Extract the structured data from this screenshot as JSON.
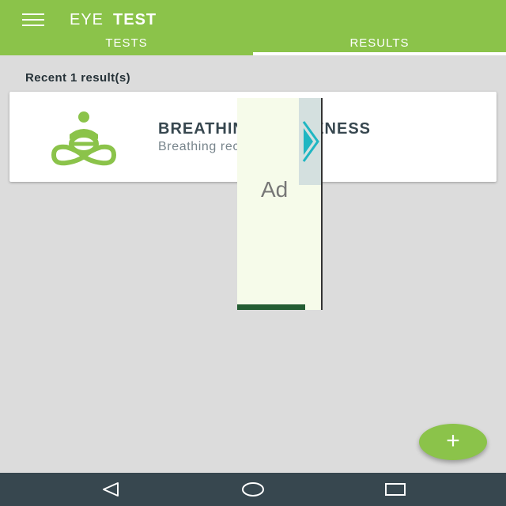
{
  "app": {
    "title_part1": "EYE",
    "title_part2": "TEST"
  },
  "tabs": [
    {
      "label": "TESTS",
      "selected": false
    },
    {
      "label": "RESULTS",
      "selected": true
    }
  ],
  "results": {
    "section_label": "Recent 1 result(s)",
    "items": [
      {
        "title": "BREATHING AWARENESS",
        "subtitle": "Breathing record / today",
        "icon": "meditation-icon"
      }
    ]
  },
  "ad": {
    "label": "Ad"
  },
  "fab": {
    "label": "+",
    "icon": "add-icon"
  },
  "nav": {
    "back_icon": "back-icon",
    "home_icon": "home-icon",
    "recents_icon": "recents-icon"
  },
  "colors": {
    "primary": "#8bc34a",
    "navbar": "#37474f",
    "background": "#dcdcdc"
  }
}
